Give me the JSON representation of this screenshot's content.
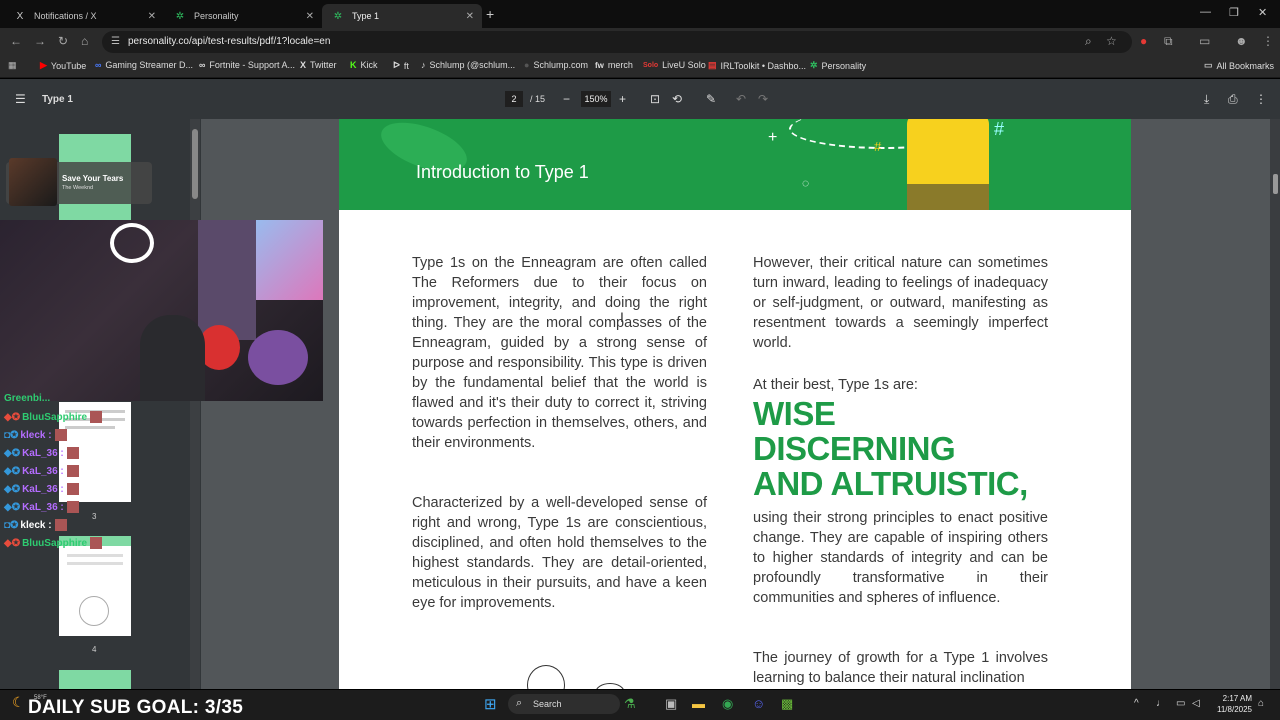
{
  "tabs": [
    {
      "label": "Notifications / X",
      "icon": "X"
    },
    {
      "label": "Personality",
      "icon": "✲"
    },
    {
      "label": "Type 1",
      "icon": "✲"
    }
  ],
  "address": {
    "url": "personality.co/api/test-results/pdf/1?locale=en"
  },
  "bookmarks": [
    {
      "label": "YouTube",
      "icon": "▶",
      "color": "#ff0000"
    },
    {
      "label": "Gaming Streamer D...",
      "icon": "∞",
      "color": "#4a7bff"
    },
    {
      "label": "Fortnite - Support A...",
      "icon": "∞",
      "color": "#ffffff"
    },
    {
      "label": "Twitter",
      "icon": "X",
      "color": "#ffffff"
    },
    {
      "label": "Kick",
      "icon": "K",
      "color": "#53fc18"
    },
    {
      "label": "ft",
      "icon": "ᐅ",
      "color": "#ffffff"
    },
    {
      "label": "Schlump (@schlum...",
      "icon": "♪",
      "color": "#ffffff"
    },
    {
      "label": "Schlump.com",
      "icon": "●",
      "color": "#222222"
    },
    {
      "label": "merch",
      "icon": "fw",
      "color": "#ffffff"
    },
    {
      "label": "LiveU Solo",
      "icon": "Solo",
      "color": "#e53935"
    },
    {
      "label": "IRLToolkit • Dashbo...",
      "icon": "▤",
      "color": "#e53935"
    },
    {
      "label": "Personality",
      "icon": "✲",
      "color": "#2ebd5f"
    }
  ],
  "all_bookmarks": "All Bookmarks",
  "pdf_toolbar": {
    "title": "Type 1",
    "page_current": "2",
    "page_total": "/ 15",
    "zoom": "150%"
  },
  "page": {
    "header_title": "Introduction to Type 1",
    "left_p1": "Type 1s on the Enneagram are often called The Reformers due to their focus on improvement, integrity, and doing the right thing. They are the moral compasses of the Enneagram, guided by a strong sense of purpose and responsibility. This type is driven by the fundamental belief that the world is flawed and it's their duty to correct it, striving towards perfection in themselves, others, and their environments.",
    "left_p2": "Characterized by a well-developed sense of right and wrong, Type 1s are conscientious, disciplined, and often hold themselves to the highest standards. They are detail-oriented, meticulous in their pursuits, and have a keen eye for improvements.",
    "right_p1": "However, their critical nature can sometimes turn inward, leading to feelings of inadequacy or self-judgment, or outward, manifesting as resentment towards a seemingly imperfect world.",
    "right_p2": "At their best, Type 1s are:",
    "big_line1": "WISE",
    "big_line2": "DISCERNING",
    "big_line3": "AND ALTRUISTIC,",
    "right_p3": "using their strong principles to enact positive change. They are capable of inspiring others to higher standards of integrity and can be profoundly transformative in their communities and spheres of influence.",
    "right_p4": "The journey of growth for a Type 1 involves learning to balance their natural inclination"
  },
  "thumbnails": {
    "num3": "3",
    "num4": "4"
  },
  "now_playing": {
    "title": "Save Your Tears",
    "artist": "The Weeknd"
  },
  "chat": [
    {
      "user": "Greenbi...",
      "color": "#2ecc71"
    },
    {
      "user": "BluuSapphire",
      "color": "#2ecc71"
    },
    {
      "user": "kleck :",
      "color": "#b56dff"
    },
    {
      "user": "KaL_36 :",
      "color": "#b56dff"
    },
    {
      "user": "KaL_36 :",
      "color": "#b56dff"
    },
    {
      "user": "KaL_36 :",
      "color": "#b56dff"
    },
    {
      "user": "KaL_36 :",
      "color": "#b56dff"
    },
    {
      "user": "kleck :",
      "color": "#ffffff"
    },
    {
      "user": "BluuSapphire",
      "color": "#2ecc71"
    }
  ],
  "stream": {
    "goal": "DAILY SUB GOAL: 3/35",
    "weather": "58°F"
  },
  "taskbar": {
    "search": "Search",
    "time": "2:17 AM",
    "date": "11/8/2025"
  }
}
